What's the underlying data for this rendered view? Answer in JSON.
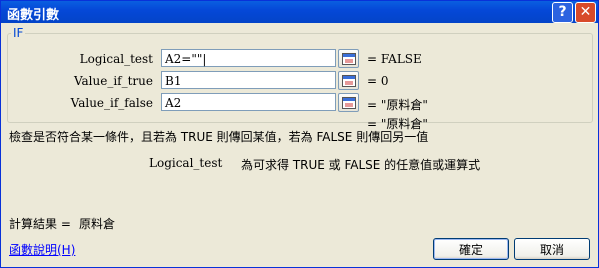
{
  "dialog": {
    "title": "函數引數",
    "help_button": "?",
    "close_button": "✕"
  },
  "function": {
    "name": "IF"
  },
  "args": [
    {
      "label": "Logical_test",
      "value": "A2=\"\"|",
      "result": "FALSE"
    },
    {
      "label": "Value_if_true",
      "value": "B1",
      "result": "0"
    },
    {
      "label": "Value_if_false",
      "value": "A2",
      "result": "\"原料倉\""
    }
  ],
  "overall_result": "= \"原料倉\"",
  "description": "檢查是否符合某一條件，且若為 TRUE 則傳回某值，若為 FALSE 則傳回另一值",
  "arg_help": {
    "name": "Logical_test",
    "text": "為可求得 TRUE 或 FALSE 的任意值或運算式"
  },
  "calc_result": {
    "label": "計算結果 =",
    "value": "原料倉"
  },
  "help_link": "函數說明(H)",
  "buttons": {
    "ok": "確定",
    "cancel": "取消"
  }
}
